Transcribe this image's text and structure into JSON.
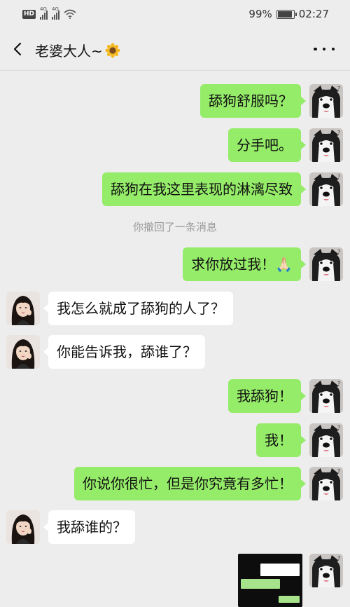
{
  "status_bar": {
    "hd": "HD",
    "network1": "4G",
    "network2": "4G",
    "battery_percent": "99%",
    "battery_level": 0.99,
    "time": "02:27"
  },
  "header": {
    "title": "老婆大人~",
    "emoji": "🌻"
  },
  "messages": [
    {
      "side": "out",
      "text": "舔狗舒服吗？"
    },
    {
      "side": "out",
      "text": "分手吧。"
    },
    {
      "side": "out",
      "text": "舔狗在我这里表现的淋漓尽致"
    },
    {
      "side": "system",
      "text": "你撤回了一条消息"
    },
    {
      "side": "out",
      "text": "求你放过我！🙏🏻"
    },
    {
      "side": "in",
      "text": "我怎么就成了舔狗的人了？"
    },
    {
      "side": "in",
      "text": "你能告诉我，舔谁了？"
    },
    {
      "side": "out",
      "text": "我舔狗！"
    },
    {
      "side": "out",
      "text": "我！"
    },
    {
      "side": "out",
      "text": "你说你很忙，但是你究竟有多忙！"
    },
    {
      "side": "in",
      "text": "我舔谁的？"
    },
    {
      "side": "out",
      "type": "image"
    }
  ],
  "colors": {
    "background": "#ededed",
    "outgoing_bubble": "#95ec69",
    "incoming_bubble": "#ffffff",
    "system_text": "#9b9b9b"
  },
  "icons": {
    "back": "chevron-left-icon",
    "more": "more-dots-icon",
    "wifi": "wifi-icon",
    "signal": "signal-icon",
    "battery": "battery-icon"
  }
}
